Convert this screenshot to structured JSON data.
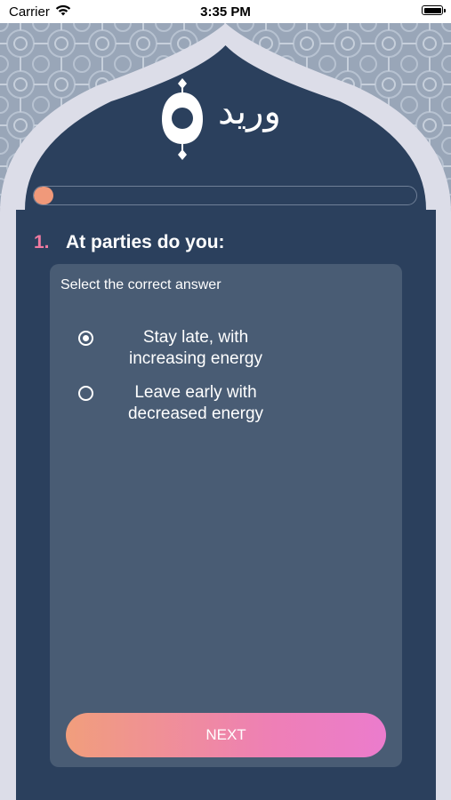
{
  "status_bar": {
    "carrier": "Carrier",
    "time": "3:35 PM"
  },
  "app": {
    "brand_name": "وريد",
    "colors": {
      "navy": "#2b405d",
      "card": "#495c74",
      "accent_peach": "#f0997a",
      "accent_pink": "#f07aa0",
      "frame": "#dcdde8"
    }
  },
  "progress": {
    "fraction": 0.05
  },
  "question": {
    "number": "1.",
    "text": "At parties do you:",
    "instruction": "Select the correct answer",
    "options": [
      {
        "label": "Stay late, with increasing energy",
        "selected": true
      },
      {
        "label": "Leave early with decreased energy",
        "selected": false
      }
    ]
  },
  "actions": {
    "next_label": "NEXT"
  }
}
